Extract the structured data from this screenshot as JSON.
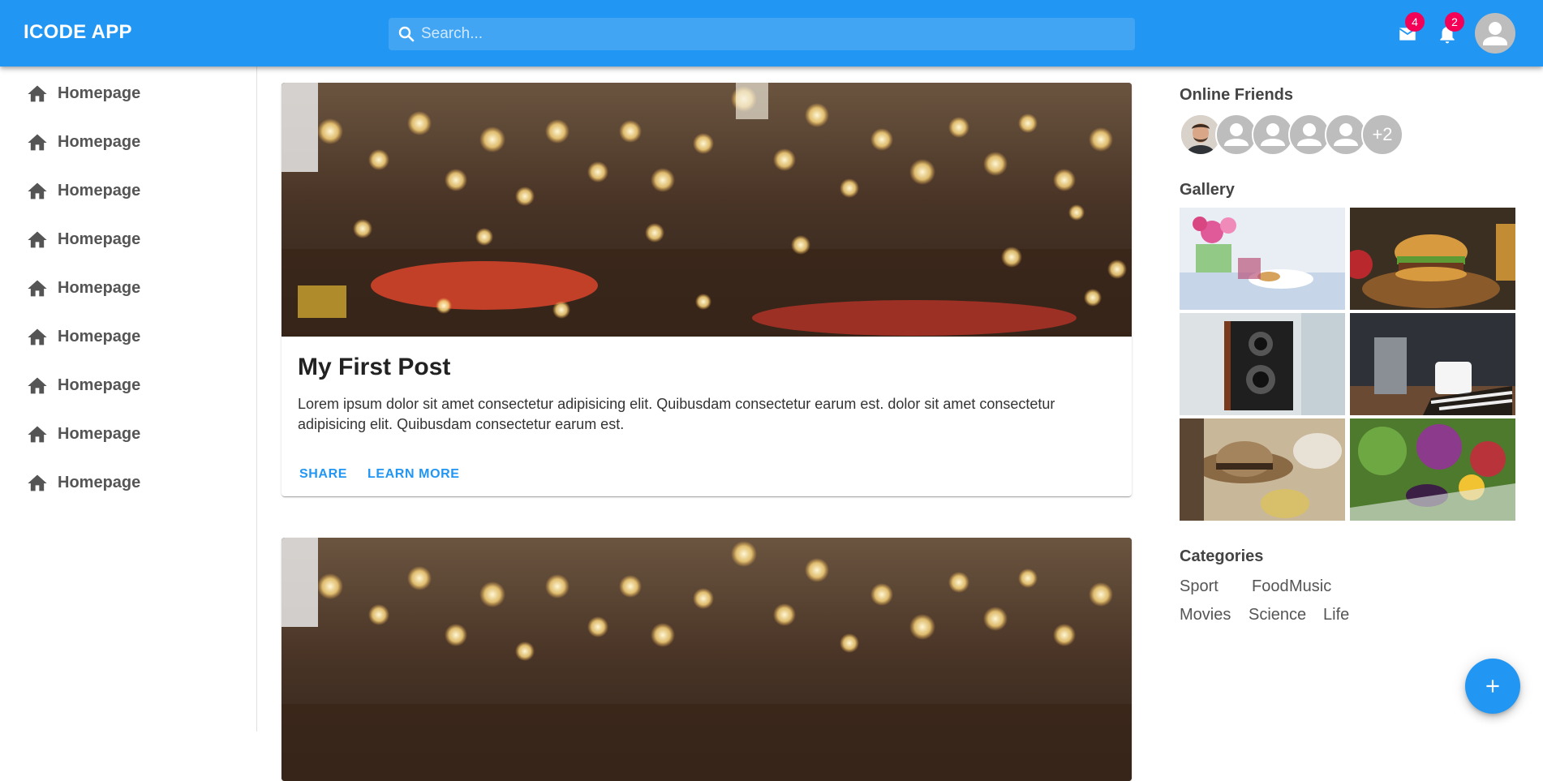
{
  "colors": {
    "primary": "#2196f3",
    "badge": "#f50057",
    "nav_text": "#555555"
  },
  "appbar": {
    "title": "ICODE APP",
    "search_placeholder": "Search...",
    "mail_count": "4",
    "notifications_count": "2",
    "icons": [
      "search-icon",
      "mail-icon",
      "bell-icon",
      "account-icon"
    ]
  },
  "sidebar": {
    "items": [
      {
        "label": "Homepage",
        "icon": "home-icon"
      },
      {
        "label": "Homepage",
        "icon": "home-icon"
      },
      {
        "label": "Homepage",
        "icon": "home-icon"
      },
      {
        "label": "Homepage",
        "icon": "home-icon"
      },
      {
        "label": "Homepage",
        "icon": "home-icon"
      },
      {
        "label": "Homepage",
        "icon": "home-icon"
      },
      {
        "label": "Homepage",
        "icon": "home-icon"
      },
      {
        "label": "Homepage",
        "icon": "home-icon"
      },
      {
        "label": "Homepage",
        "icon": "home-icon"
      }
    ]
  },
  "feed": {
    "posts": [
      {
        "title": "My First Post",
        "body": "Lorem ipsum dolor sit amet consectetur adipisicing elit. Quibusdam consectetur earum est. dolor sit amet consectetur adipisicing elit. Quibusdam consectetur earum est.",
        "share_label": "SHARE",
        "learn_more_label": "LEARN MORE"
      },
      {
        "title": "",
        "body": ""
      }
    ]
  },
  "rightbar": {
    "online_friends_title": "Online Friends",
    "friends_more": "+2",
    "gallery_title": "Gallery",
    "categories_title": "Categories",
    "categories": [
      "Sport",
      "Food",
      "Music",
      "Movies",
      "Science",
      "Life"
    ]
  },
  "fab": {
    "icon": "add-icon"
  }
}
